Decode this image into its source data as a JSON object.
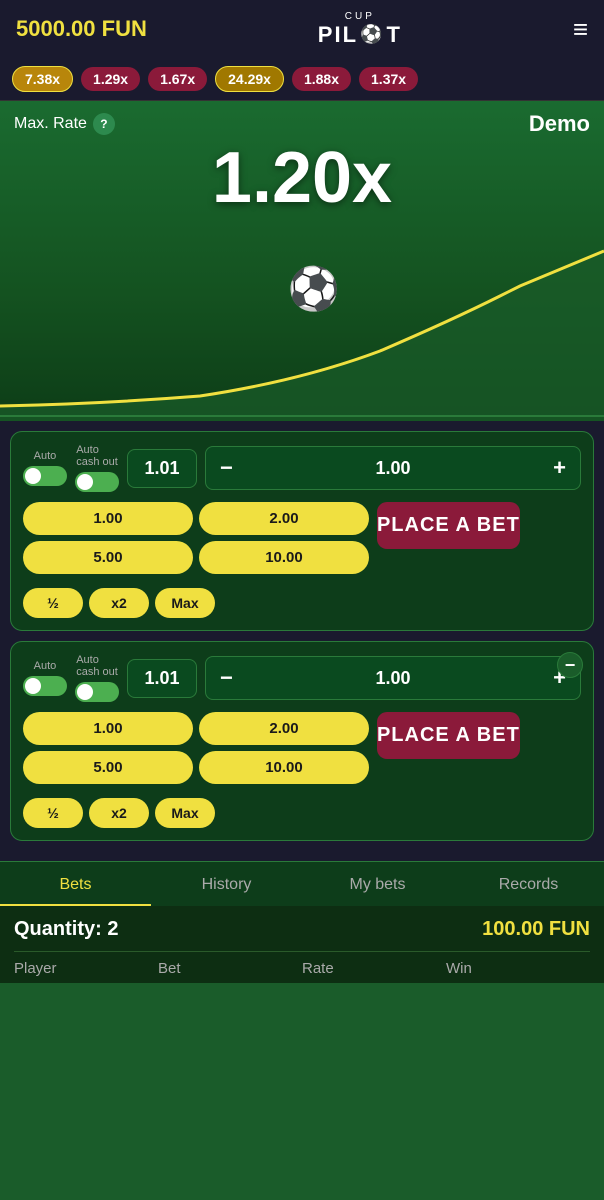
{
  "header": {
    "balance": "5000.00 FUN",
    "logo_cup": "CUP",
    "logo_pilot": "PIL T",
    "hamburger": "≡"
  },
  "multiplier_bar": [
    {
      "value": "7.38x",
      "style": "yellow"
    },
    {
      "value": "1.29x",
      "style": "red"
    },
    {
      "value": "1.67x",
      "style": "red"
    },
    {
      "value": "24.29x",
      "style": "yellow"
    },
    {
      "value": "1.88x",
      "style": "red"
    },
    {
      "value": "1.37x",
      "style": "red"
    }
  ],
  "game": {
    "max_rate_label": "Max. Rate",
    "demo_label": "Demo",
    "current_multiplier": "1.20x"
  },
  "panels": [
    {
      "id": "panel1",
      "auto_label": "Auto",
      "auto_cashout_label": "Auto cash out",
      "cashout_value": "1.01",
      "bet_amount": "1.00",
      "quick_bets": [
        "1.00",
        "2.00",
        "5.00",
        "10.00"
      ],
      "frac_buttons": [
        "½",
        "x2",
        "Max"
      ],
      "place_bet_label": "PLACE A BET",
      "has_remove": false
    },
    {
      "id": "panel2",
      "auto_label": "Auto",
      "auto_cashout_label": "Auto cash out",
      "cashout_value": "1.01",
      "bet_amount": "1.00",
      "quick_bets": [
        "1.00",
        "2.00",
        "5.00",
        "10.00"
      ],
      "frac_buttons": [
        "½",
        "x2",
        "Max"
      ],
      "place_bet_label": "PLACE A BET",
      "has_remove": true
    }
  ],
  "tabs": [
    {
      "label": "Bets",
      "active": true
    },
    {
      "label": "History",
      "active": false
    },
    {
      "label": "My bets",
      "active": false
    },
    {
      "label": "Records",
      "active": false
    }
  ],
  "bottom": {
    "quantity_label": "Quantity: 2",
    "amount_label": "100.00 FUN",
    "columns": [
      "Player",
      "Bet",
      "Rate",
      "Win"
    ]
  }
}
